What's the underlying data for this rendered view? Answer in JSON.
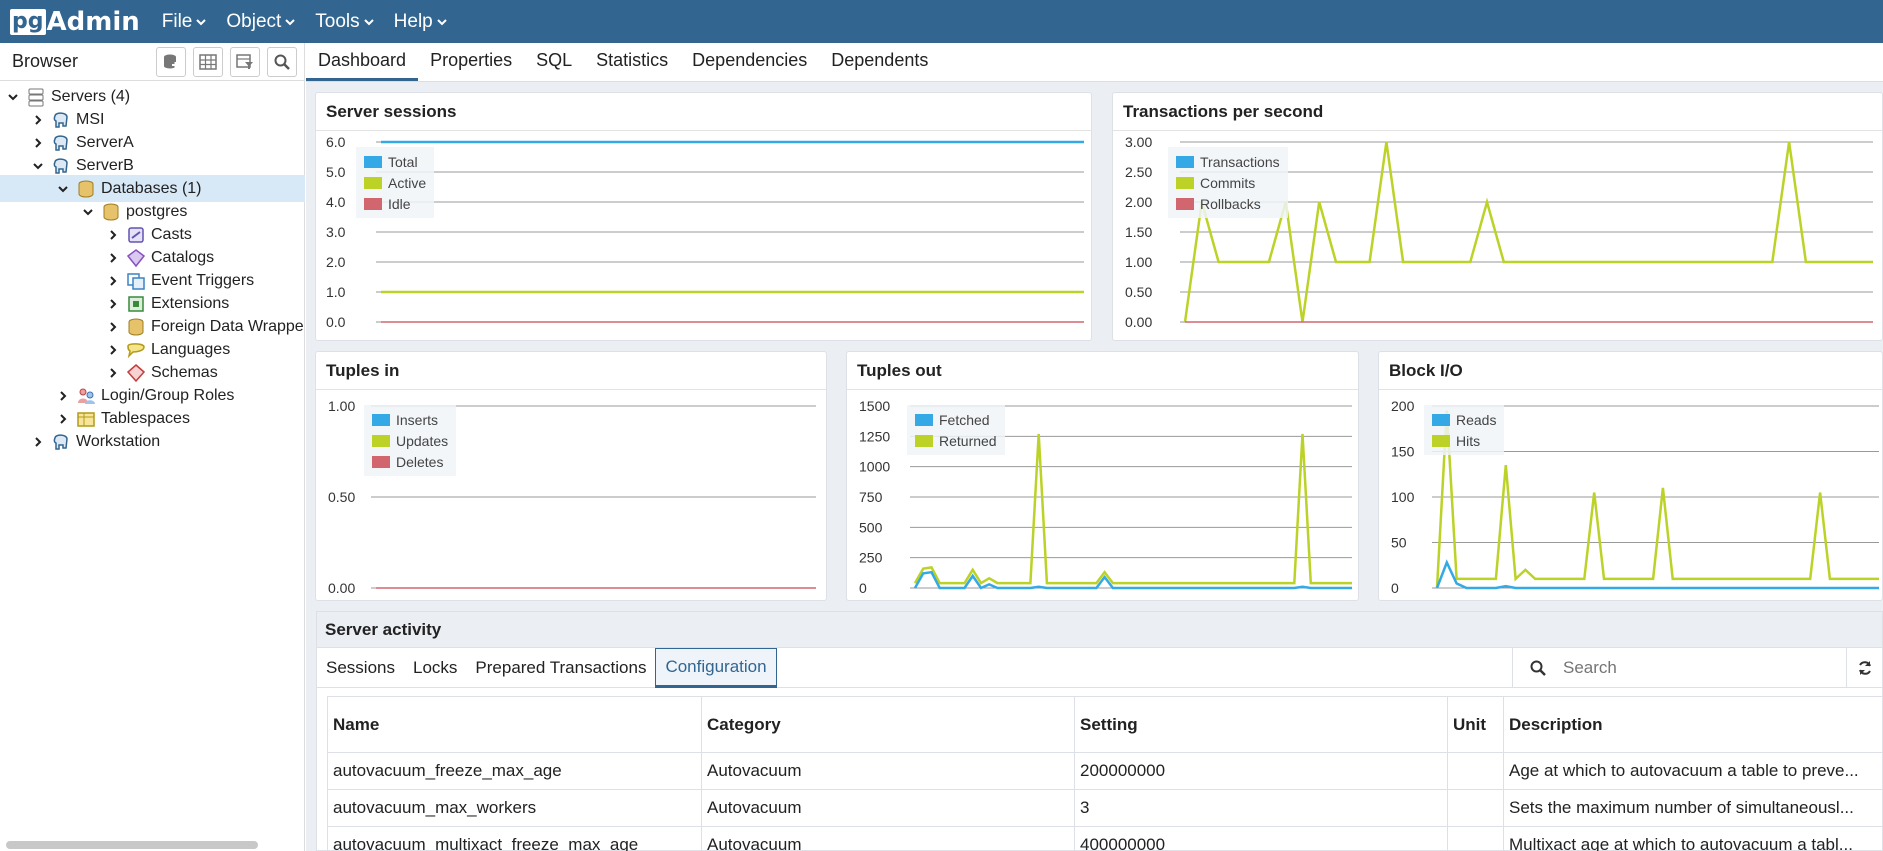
{
  "navbar": {
    "logo_pg": "pg",
    "logo_admin": "Admin",
    "menus": [
      "File",
      "Object",
      "Tools",
      "Help"
    ]
  },
  "browser": {
    "title": "Browser",
    "tree": [
      {
        "label": "Servers (4)",
        "icon": "servers-icon"
      },
      {
        "label": "MSI",
        "icon": "elephant-icon"
      },
      {
        "label": "ServerA",
        "icon": "elephant-icon"
      },
      {
        "label": "ServerB",
        "icon": "elephant-icon"
      },
      {
        "label": "Databases (1)",
        "icon": "databases-icon"
      },
      {
        "label": "postgres",
        "icon": "database-icon"
      },
      {
        "label": "Casts",
        "icon": "casts-icon"
      },
      {
        "label": "Catalogs",
        "icon": "catalogs-icon"
      },
      {
        "label": "Event Triggers",
        "icon": "event-triggers-icon"
      },
      {
        "label": "Extensions",
        "icon": "extensions-icon"
      },
      {
        "label": "Foreign Data Wrappe",
        "icon": "fdw-icon"
      },
      {
        "label": "Languages",
        "icon": "languages-icon"
      },
      {
        "label": "Schemas",
        "icon": "schemas-icon"
      },
      {
        "label": "Login/Group Roles",
        "icon": "roles-icon"
      },
      {
        "label": "Tablespaces",
        "icon": "tablespaces-icon"
      },
      {
        "label": "Workstation",
        "icon": "elephant-icon"
      }
    ]
  },
  "tabs": [
    "Dashboard",
    "Properties",
    "SQL",
    "Statistics",
    "Dependencies",
    "Dependents"
  ],
  "colors": {
    "blue": "#34a9e6",
    "green": "#bcd227",
    "red": "#d1666e",
    "brand": "#326690"
  },
  "chart_data": [
    {
      "type": "line",
      "title": "Server sessions",
      "ylim": [
        0,
        6
      ],
      "yticks": [
        "6.0",
        "5.0",
        "4.0",
        "3.0",
        "2.0",
        "1.0",
        "0.0"
      ],
      "legend": [
        "Total",
        "Active",
        "Idle"
      ],
      "series": [
        {
          "name": "Total",
          "values": [
            6,
            6,
            6,
            6,
            6,
            6,
            6,
            6,
            6,
            6,
            6,
            6,
            6,
            6,
            6,
            6,
            6,
            6,
            6,
            6
          ]
        },
        {
          "name": "Active",
          "values": [
            1,
            1,
            1,
            1,
            1,
            1,
            1,
            1,
            1,
            1,
            1,
            1,
            1,
            1,
            1,
            1,
            1,
            1,
            1,
            1
          ]
        },
        {
          "name": "Idle",
          "values": [
            0,
            0,
            0,
            0,
            0,
            0,
            0,
            0,
            0,
            0,
            0,
            0,
            0,
            0,
            0,
            0,
            0,
            0,
            0,
            0
          ]
        }
      ]
    },
    {
      "type": "line",
      "title": "Transactions per second",
      "ylim": [
        0,
        3
      ],
      "yticks": [
        "3.00",
        "2.50",
        "2.00",
        "1.50",
        "1.00",
        "0.50",
        "0.00"
      ],
      "legend": [
        "Transactions",
        "Commits",
        "Rollbacks"
      ],
      "series": [
        {
          "name": "Commits",
          "values": [
            0,
            2,
            1,
            1,
            1,
            1,
            2,
            0,
            2,
            1,
            1,
            1,
            3,
            1,
            1,
            1,
            1,
            1,
            2,
            1,
            1,
            1,
            1,
            1,
            1,
            1,
            1,
            1,
            1,
            1,
            1,
            1,
            1,
            1,
            1,
            1,
            3,
            1,
            1,
            1,
            1,
            1
          ]
        },
        {
          "name": "Rollbacks",
          "values": [
            0,
            0,
            0,
            0,
            0,
            0,
            0,
            0,
            0,
            0,
            0,
            0,
            0,
            0,
            0,
            0,
            0,
            0,
            0,
            0,
            0,
            0,
            0,
            0,
            0,
            0,
            0,
            0,
            0,
            0,
            0,
            0,
            0,
            0,
            0,
            0,
            0,
            0,
            0,
            0,
            0,
            0
          ]
        }
      ]
    },
    {
      "type": "line",
      "title": "Tuples in",
      "ylim": [
        0,
        1
      ],
      "yticks": [
        "1.00",
        "0.50",
        "0.00"
      ],
      "legend": [
        "Inserts",
        "Updates",
        "Deletes"
      ],
      "series": [
        {
          "name": "Deletes",
          "values": [
            0,
            0,
            0,
            0,
            0,
            0,
            0,
            0,
            0,
            0,
            0,
            0,
            0,
            0,
            0,
            0,
            0,
            0,
            0,
            0
          ]
        }
      ]
    },
    {
      "type": "line",
      "title": "Tuples out",
      "ylim": [
        0,
        1500
      ],
      "yticks": [
        "1500",
        "1250",
        "1000",
        "750",
        "500",
        "250",
        "0"
      ],
      "legend": [
        "Fetched",
        "Returned"
      ],
      "series": [
        {
          "name": "Returned",
          "values": [
            40,
            160,
            170,
            40,
            40,
            40,
            40,
            150,
            40,
            80,
            40,
            40,
            40,
            40,
            40,
            1270,
            40,
            40,
            40,
            40,
            40,
            40,
            40,
            130,
            40,
            40,
            40,
            40,
            40,
            40,
            40,
            40,
            40,
            40,
            40,
            40,
            40,
            40,
            40,
            40,
            40,
            40,
            40,
            40,
            40,
            40,
            40,
            1270,
            40,
            40,
            40,
            40,
            40,
            40
          ]
        },
        {
          "name": "Fetched",
          "values": [
            0,
            120,
            130,
            0,
            0,
            0,
            0,
            100,
            0,
            30,
            0,
            0,
            0,
            0,
            0,
            10,
            0,
            0,
            0,
            0,
            0,
            0,
            0,
            90,
            0,
            0,
            0,
            0,
            0,
            0,
            0,
            0,
            0,
            0,
            0,
            0,
            0,
            0,
            0,
            0,
            0,
            0,
            0,
            0,
            0,
            0,
            0,
            10,
            0,
            0,
            0,
            0,
            0,
            0
          ]
        }
      ]
    },
    {
      "type": "line",
      "title": "Block I/O",
      "ylim": [
        0,
        200
      ],
      "yticks": [
        "200",
        "150",
        "100",
        "50",
        "0"
      ],
      "legend": [
        "Reads",
        "Hits"
      ],
      "series": [
        {
          "name": "Hits",
          "values": [
            0,
            195,
            10,
            10,
            10,
            10,
            10,
            135,
            10,
            20,
            10,
            10,
            10,
            10,
            10,
            10,
            105,
            10,
            10,
            10,
            10,
            10,
            10,
            110,
            10,
            10,
            10,
            10,
            10,
            10,
            10,
            10,
            10,
            10,
            10,
            10,
            10,
            10,
            10,
            105,
            10,
            10,
            10,
            10,
            10,
            10
          ]
        },
        {
          "name": "Reads",
          "values": [
            0,
            28,
            5,
            0,
            0,
            0,
            0,
            2,
            0,
            0,
            0,
            0,
            0,
            0,
            0,
            0,
            0,
            0,
            0,
            0,
            0,
            0,
            0,
            0,
            0,
            0,
            0,
            0,
            0,
            0,
            0,
            0,
            0,
            0,
            0,
            0,
            0,
            0,
            0,
            0,
            0,
            0,
            0,
            0,
            0,
            0
          ]
        }
      ]
    }
  ],
  "activity": {
    "title": "Server activity",
    "tabs": [
      "Sessions",
      "Locks",
      "Prepared Transactions",
      "Configuration"
    ],
    "active_tab": "Configuration",
    "search_placeholder": "Search",
    "columns": [
      "Name",
      "Category",
      "Setting",
      "Unit",
      "Description"
    ],
    "rows": [
      [
        "autovacuum_freeze_max_age",
        "Autovacuum",
        "200000000",
        "",
        "Age at which to autovacuum a table to preve..."
      ],
      [
        "autovacuum_max_workers",
        "Autovacuum",
        "3",
        "",
        "Sets the maximum number of simultaneousl..."
      ],
      [
        "autovacuum_multixact_freeze_max_age",
        "Autovacuum",
        "400000000",
        "",
        "Multixact age at which to autovacuum a tabl..."
      ]
    ]
  }
}
